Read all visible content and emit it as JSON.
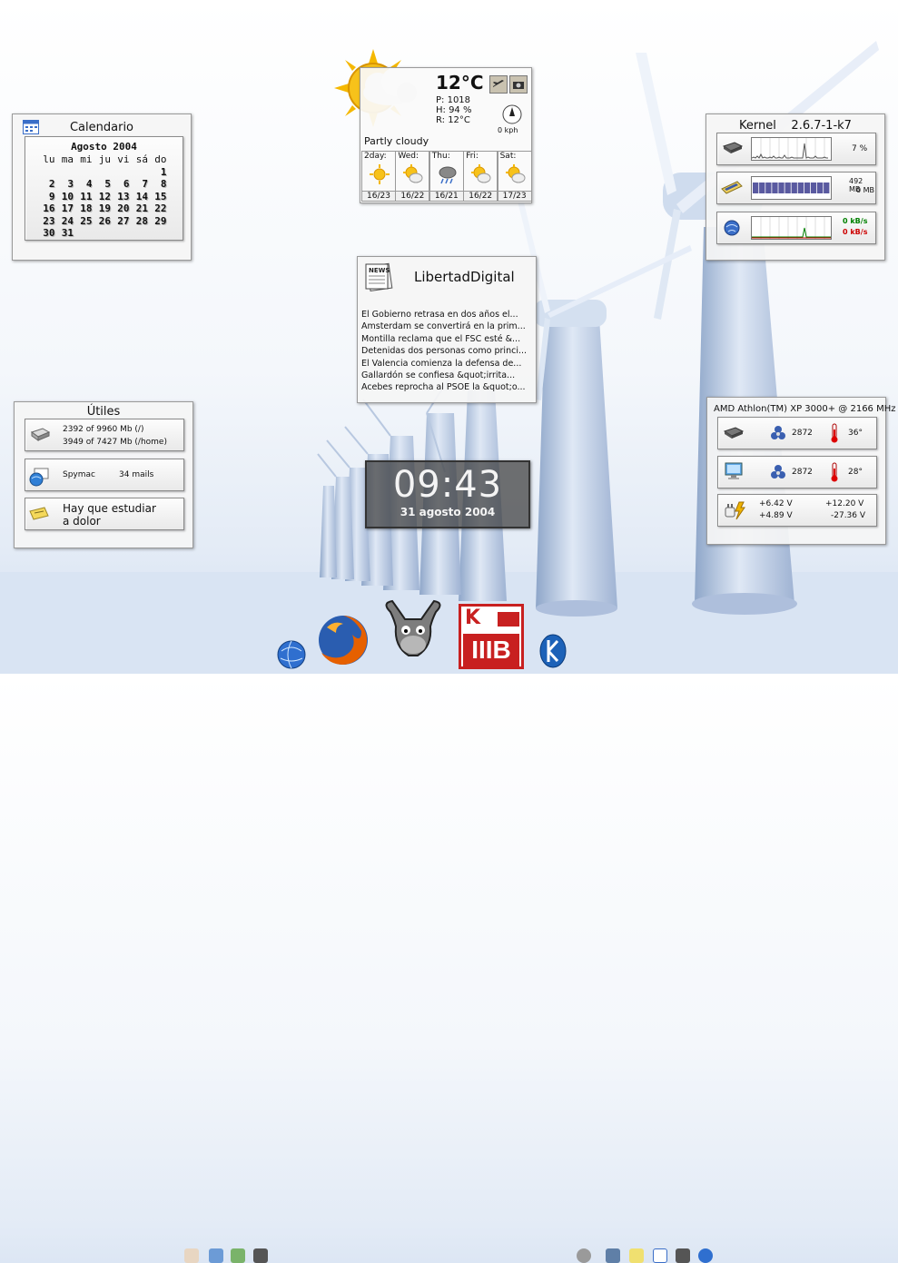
{
  "calendar": {
    "title": "Calendario",
    "month": "Agosto 2004",
    "weekdays": [
      "lu",
      "ma",
      "mi",
      "ju",
      "vi",
      "sá",
      "do"
    ],
    "weeks": [
      [
        "",
        "",
        "",
        "",
        "",
        "",
        "1"
      ],
      [
        "2",
        "3",
        "4",
        "5",
        "6",
        "7",
        "8"
      ],
      [
        "9",
        "10",
        "11",
        "12",
        "13",
        "14",
        "15"
      ],
      [
        "16",
        "17",
        "18",
        "19",
        "20",
        "21",
        "22"
      ],
      [
        "23",
        "24",
        "25",
        "26",
        "27",
        "28",
        "29"
      ],
      [
        "30",
        "31",
        "",
        "",
        "",
        "",
        ""
      ]
    ]
  },
  "weather": {
    "temperature": "12°C",
    "pressure": "P: 1018",
    "humidity": "H: 94 %",
    "real": "R: 12°C",
    "wind": "0 kph",
    "condition": "Partly cloudy",
    "forecast": [
      {
        "day": "2day:",
        "temps": "16/23",
        "icon": "sun-icon"
      },
      {
        "day": "Wed:",
        "temps": "16/22",
        "icon": "sun-cloud-icon"
      },
      {
        "day": "Thu:",
        "temps": "16/21",
        "icon": "rain-icon"
      },
      {
        "day": "Fri:",
        "temps": "16/22",
        "icon": "sun-cloud-icon"
      },
      {
        "day": "Sat:",
        "temps": "17/23",
        "icon": "sun-cloud-icon"
      }
    ]
  },
  "news": {
    "title": "LibertadDigital",
    "icon_text": "NEWS",
    "items": [
      "El Gobierno retrasa en dos años el...",
      "Amsterdam se convertirá en la prim...",
      "Montilla reclama que el FSC esté &...",
      "Detenidas dos personas como princi...",
      "El Valencia comienza la defensa de...",
      "Gallardón se confiesa &quot;irrita...",
      "Acebes reprocha al PSOE la &quot;o..."
    ]
  },
  "utiles": {
    "title": "Útiles",
    "disk_line1": "2392  of 9960 Mb (/)",
    "disk_line2": "3949  of 7427 Mb (/home)",
    "mail_account": "Spymac",
    "mail_count": "34 mails",
    "note_line1": "Hay que estudiar",
    "note_line2": "a dolor"
  },
  "kernel": {
    "title": "Kernel    2.6.7-1-k7",
    "cpu_load": "7 %",
    "mem_used": "492 MB",
    "swap_used": "0 MB",
    "net_in": "0 kB/s",
    "net_out": "0 kB/s",
    "mem_fraction": 0.92
  },
  "hardware": {
    "title": "AMD Athlon(TM) XP 3000+ @ 2166 MHz",
    "cpu_fan": "2872",
    "cpu_temp": "36°",
    "sys_fan": "2872",
    "sys_temp": "28°",
    "v1": "+6.42 V",
    "v2": "+12.20 V",
    "v3": "+4.89 V",
    "v4": "-27.36 V"
  },
  "clock": {
    "time": "09:43",
    "date": "31 agosto 2004"
  },
  "dock": {
    "kde_label": "IIIB",
    "kde_top": "K"
  },
  "colors": {
    "net_in": "#008000",
    "net_out": "#cc0000",
    "graph_fill": "#5a5aa0",
    "firefox": "#e66000"
  }
}
